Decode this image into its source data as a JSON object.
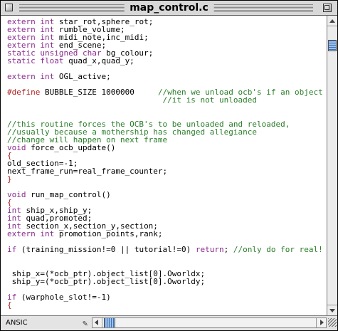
{
  "window": {
    "title": "map_control.c"
  },
  "editor": {
    "lines": [
      [
        {
          "t": "extern int ",
          "c": "kw"
        },
        {
          "t": "star_rot,sphere_rot;",
          "c": ""
        }
      ],
      [
        {
          "t": "extern int ",
          "c": "kw"
        },
        {
          "t": "rumble_volume;",
          "c": ""
        }
      ],
      [
        {
          "t": "extern int ",
          "c": "kw"
        },
        {
          "t": "midi_note,inc_midi;",
          "c": ""
        }
      ],
      [
        {
          "t": "extern int ",
          "c": "kw"
        },
        {
          "t": "end_scene;",
          "c": ""
        }
      ],
      [
        {
          "t": "static unsigned char ",
          "c": "kw"
        },
        {
          "t": "bg_colour;",
          "c": ""
        }
      ],
      [
        {
          "t": "static float ",
          "c": "kw"
        },
        {
          "t": "quad_x,quad_y;",
          "c": ""
        }
      ],
      [],
      [
        {
          "t": "extern int ",
          "c": "kw"
        },
        {
          "t": "OGL_active;",
          "c": ""
        }
      ],
      [],
      [
        {
          "t": "#define ",
          "c": "pp"
        },
        {
          "t": "BUBBLE_SIZE 1000000     ",
          "c": ""
        },
        {
          "t": "//when we unload ocb's if an object is wit",
          "c": "cm"
        }
      ],
      [
        {
          "t": "                                 ",
          "c": ""
        },
        {
          "t": "//it is not unloaded",
          "c": "cm"
        }
      ],
      [],
      [],
      [
        {
          "t": "//this routine forces the OCB's to be unloaded and reloaded,",
          "c": "cm"
        }
      ],
      [
        {
          "t": "//usually because a mothership has changed allegiance",
          "c": "cm"
        }
      ],
      [
        {
          "t": "//change will happen on next frame",
          "c": "cm"
        }
      ],
      [
        {
          "t": "void ",
          "c": "kw"
        },
        {
          "t": "force_ocb_update()",
          "c": ""
        }
      ],
      [
        {
          "t": "{",
          "c": "pp"
        }
      ],
      [
        {
          "t": "old_section=-1;",
          "c": ""
        }
      ],
      [
        {
          "t": "next_frame_run=real_frame_counter;",
          "c": ""
        }
      ],
      [
        {
          "t": "}",
          "c": "pp"
        }
      ],
      [],
      [
        {
          "t": "void ",
          "c": "kw"
        },
        {
          "t": "run_map_control()",
          "c": ""
        }
      ],
      [
        {
          "t": "{",
          "c": "pp"
        }
      ],
      [
        {
          "t": "int ",
          "c": "kw"
        },
        {
          "t": "ship_x,ship_y;",
          "c": ""
        }
      ],
      [
        {
          "t": "int ",
          "c": "kw"
        },
        {
          "t": "quad,promoted;",
          "c": ""
        }
      ],
      [
        {
          "t": "int ",
          "c": "kw"
        },
        {
          "t": "section_x,section_y,section;",
          "c": ""
        }
      ],
      [
        {
          "t": "extern int ",
          "c": "kw"
        },
        {
          "t": "promotion_points,rank;",
          "c": ""
        }
      ],
      [],
      [
        {
          "t": "if ",
          "c": "kw"
        },
        {
          "t": "(training_mission!=0 || tutorial!=0) ",
          "c": ""
        },
        {
          "t": "return",
          "c": "kw"
        },
        {
          "t": "; ",
          "c": ""
        },
        {
          "t": "//only do for real!",
          "c": "cm"
        }
      ],
      [],
      [],
      [
        {
          "t": " ship_x=(*ocb_ptr).object_list[0].Oworldx;",
          "c": ""
        }
      ],
      [
        {
          "t": " ship_y=(*ocb_ptr).object_list[0].Oworldy;",
          "c": ""
        }
      ],
      [],
      [
        {
          "t": "if ",
          "c": "kw"
        },
        {
          "t": "(warphole_slot!=-1)",
          "c": ""
        }
      ],
      [
        {
          "t": "{",
          "c": "pp"
        }
      ]
    ]
  },
  "statusbar": {
    "language": "ANSIC"
  },
  "colors": {
    "keyword": "#8a2b8e",
    "comment": "#2a7d2a",
    "preprocessor": "#b02020"
  }
}
